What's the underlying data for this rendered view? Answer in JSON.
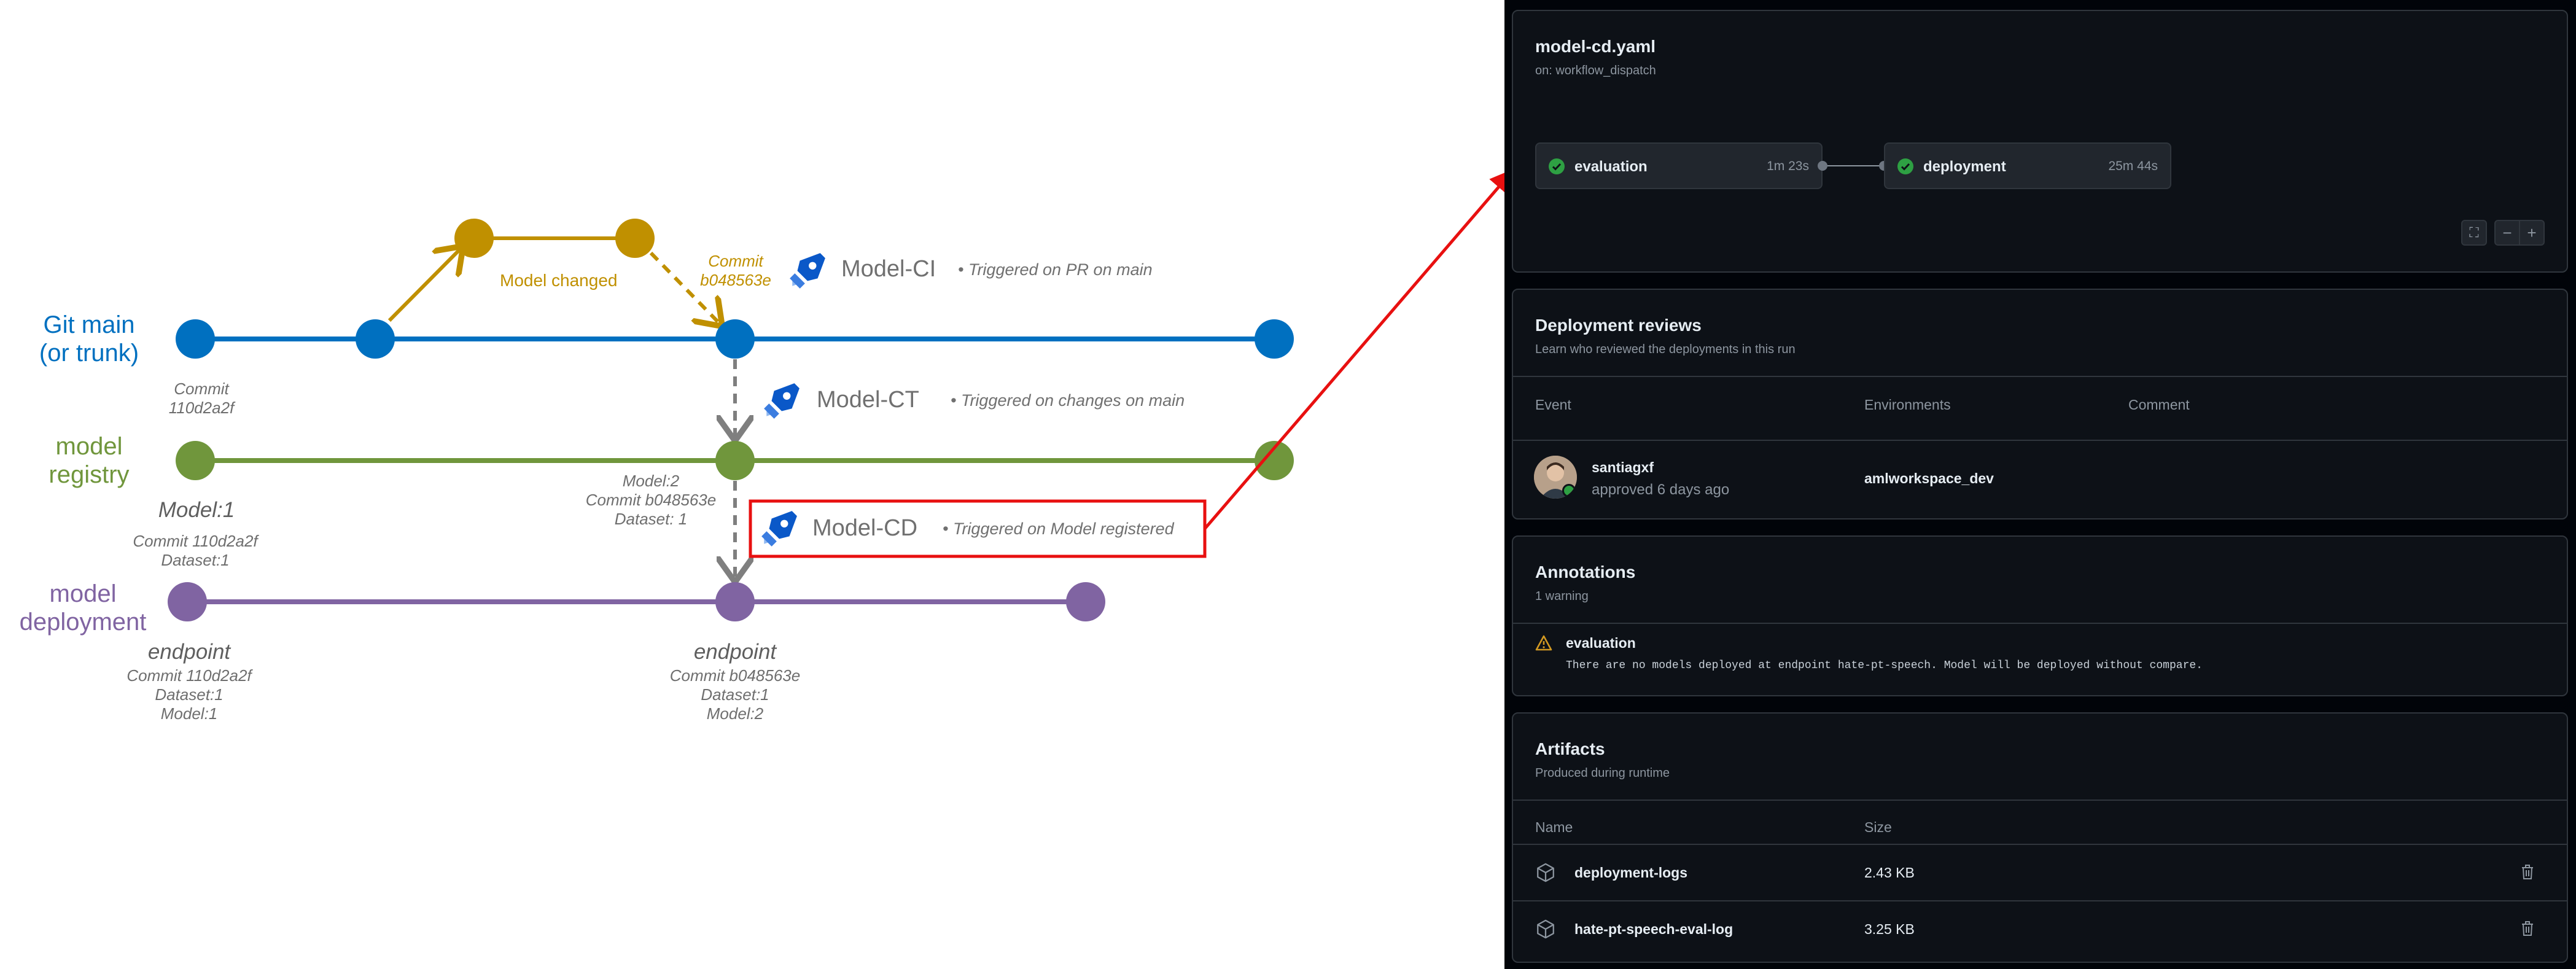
{
  "diagram": {
    "lanes": {
      "git": "Git main\n(or trunk)",
      "registry": "model\nregistry",
      "deployment": "model\ndeployment"
    },
    "branch_label": "Model changed",
    "commit_label": "Commit\nb048563e",
    "commit_git": "Commit\n110d2a2f",
    "model1": "Model:1",
    "model1_details": "Commit 110d2a2f\nDataset:1",
    "model2_details": "Model:2\nCommit b048563e\nDataset: 1",
    "endpoint1_title": "endpoint",
    "endpoint1_details": "Commit 110d2a2f\nDataset:1\nModel:1",
    "endpoint2_title": "endpoint",
    "endpoint2_details": "Commit b048563e\nDataset:1\nModel:2",
    "workflows": [
      {
        "name": "Model-CI",
        "trigger": "• Triggered on PR on main"
      },
      {
        "name": "Model-CT",
        "trigger": "• Triggered on changes on main"
      },
      {
        "name": "Model-CD",
        "trigger": "• Triggered on Model registered"
      }
    ],
    "colors": {
      "git": "#0070c0",
      "branch": "#c09000",
      "registry": "#70963c",
      "deployment": "#8064a2",
      "highlight": "#e81010"
    }
  },
  "workflow_run": {
    "file": "model-cd.yaml",
    "trigger": "on: workflow_dispatch",
    "jobs": [
      {
        "name": "evaluation",
        "duration": "1m 23s",
        "status": "success"
      },
      {
        "name": "deployment",
        "duration": "25m 44s",
        "status": "success"
      }
    ],
    "zoom_controls": {
      "fullscreen": "⛶",
      "zoom_out": "−",
      "zoom_in": "+"
    }
  },
  "deployment_reviews": {
    "title": "Deployment reviews",
    "subtitle": "Learn who reviewed the deployments in this run",
    "columns": [
      "Event",
      "Environments",
      "Comment"
    ],
    "rows": [
      {
        "user": "santiagxf",
        "event": "approved 6 days ago",
        "environment": "amlworkspace_dev",
        "comment": ""
      }
    ]
  },
  "annotations": {
    "title": "Annotations",
    "count": "1 warning",
    "items": [
      {
        "level": "warning",
        "title": "evaluation",
        "message": "There are no models deployed at endpoint hate-pt-speech. Model will be deployed without compare."
      }
    ]
  },
  "artifacts": {
    "title": "Artifacts",
    "subtitle": "Produced during runtime",
    "columns": [
      "Name",
      "Size"
    ],
    "rows": [
      {
        "name": "deployment-logs",
        "size": "2.43 KB"
      },
      {
        "name": "hate-pt-speech-eval-log",
        "size": "3.25 KB"
      }
    ]
  }
}
